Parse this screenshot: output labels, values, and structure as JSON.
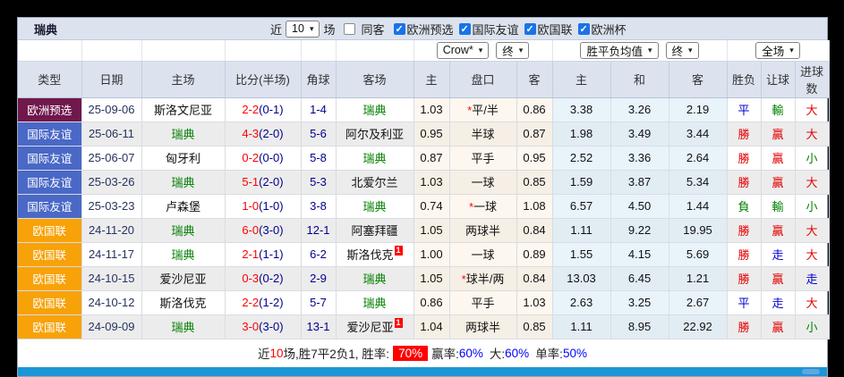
{
  "toolbar": {
    "team": "瑞典",
    "recent_label": "近",
    "recent_value": "10",
    "matches_label": "场",
    "same_venue_label": "同客",
    "same_venue_checked": false,
    "filters": [
      {
        "label": "欧洲预选",
        "checked": true
      },
      {
        "label": "国际友谊",
        "checked": true
      },
      {
        "label": "欧国联",
        "checked": true
      },
      {
        "label": "欧洲杯",
        "checked": true
      }
    ]
  },
  "selects": {
    "company": "Crow*",
    "ah_state": "终",
    "odds_mean": "胜平负均值",
    "odds_state": "终",
    "scope": "全场"
  },
  "table": {
    "headers": [
      "类型",
      "日期",
      "主场",
      "比分(半场)",
      "角球",
      "客场",
      "主",
      "盘口",
      "客",
      "主",
      "和",
      "客",
      "胜负",
      "让球",
      "进球数"
    ],
    "rows": [
      {
        "type": "欧洲预选",
        "date": "25-09-06",
        "home": "斯洛文尼亚",
        "home_team": false,
        "home_card": "",
        "ft": "2-2",
        "ht": "(0-1)",
        "corner": "1-4",
        "away": "瑞典",
        "away_team": true,
        "away_card": "",
        "ah_home": "1.03",
        "ah_star": true,
        "ah_line": "平/半",
        "ah_away": "0.86",
        "o_home": "3.38",
        "o_draw": "3.26",
        "o_away": "2.19",
        "res": "平",
        "res_c": "blue",
        "ah_res": "輸",
        "ah_res_c": "green",
        "goal": "大",
        "goal_c": "red"
      },
      {
        "type": "国际友谊",
        "date": "25-06-11",
        "home": "瑞典",
        "home_team": true,
        "home_card": "",
        "ft": "4-3",
        "ht": "(2-0)",
        "corner": "5-6",
        "away": "阿尔及利亚",
        "away_team": false,
        "away_card": "",
        "ah_home": "0.95",
        "ah_star": false,
        "ah_line": "半球",
        "ah_away": "0.87",
        "o_home": "1.98",
        "o_draw": "3.49",
        "o_away": "3.44",
        "res": "勝",
        "res_c": "red",
        "ah_res": "贏",
        "ah_res_c": "red",
        "goal": "大",
        "goal_c": "red"
      },
      {
        "type": "国际友谊",
        "date": "25-06-07",
        "home": "匈牙利",
        "home_team": false,
        "home_card": "",
        "ft": "0-2",
        "ht": "(0-0)",
        "corner": "5-8",
        "away": "瑞典",
        "away_team": true,
        "away_card": "",
        "ah_home": "0.87",
        "ah_star": false,
        "ah_line": "平手",
        "ah_away": "0.95",
        "o_home": "2.52",
        "o_draw": "3.36",
        "o_away": "2.64",
        "res": "勝",
        "res_c": "red",
        "ah_res": "贏",
        "ah_res_c": "red",
        "goal": "小",
        "goal_c": "green"
      },
      {
        "type": "国际友谊",
        "date": "25-03-26",
        "home": "瑞典",
        "home_team": true,
        "home_card": "",
        "ft": "5-1",
        "ht": "(2-0)",
        "corner": "5-3",
        "away": "北爱尔兰",
        "away_team": false,
        "away_card": "",
        "ah_home": "1.03",
        "ah_star": false,
        "ah_line": "一球",
        "ah_away": "0.85",
        "o_home": "1.59",
        "o_draw": "3.87",
        "o_away": "5.34",
        "res": "勝",
        "res_c": "red",
        "ah_res": "贏",
        "ah_res_c": "red",
        "goal": "大",
        "goal_c": "red"
      },
      {
        "type": "国际友谊",
        "date": "25-03-23",
        "home": "卢森堡",
        "home_team": false,
        "home_card": "",
        "ft": "1-0",
        "ht": "(1-0)",
        "corner": "3-8",
        "away": "瑞典",
        "away_team": true,
        "away_card": "",
        "ah_home": "0.74",
        "ah_star": true,
        "ah_line": "一球",
        "ah_away": "1.08",
        "o_home": "6.57",
        "o_draw": "4.50",
        "o_away": "1.44",
        "res": "負",
        "res_c": "green",
        "ah_res": "輸",
        "ah_res_c": "green",
        "goal": "小",
        "goal_c": "green"
      },
      {
        "type": "欧国联",
        "date": "24-11-20",
        "home": "瑞典",
        "home_team": true,
        "home_card": "",
        "ft": "6-0",
        "ht": "(3-0)",
        "corner": "12-1",
        "away": "阿塞拜疆",
        "away_team": false,
        "away_card": "",
        "ah_home": "1.05",
        "ah_star": false,
        "ah_line": "两球半",
        "ah_away": "0.84",
        "o_home": "1.11",
        "o_draw": "9.22",
        "o_away": "19.95",
        "res": "勝",
        "res_c": "red",
        "ah_res": "贏",
        "ah_res_c": "red",
        "goal": "大",
        "goal_c": "red"
      },
      {
        "type": "欧国联",
        "date": "24-11-17",
        "home": "瑞典",
        "home_team": true,
        "home_card": "",
        "ft": "2-1",
        "ht": "(1-1)",
        "corner": "6-2",
        "away": "斯洛伐克",
        "away_team": false,
        "away_card": "1",
        "ah_home": "1.00",
        "ah_star": false,
        "ah_line": "一球",
        "ah_away": "0.89",
        "o_home": "1.55",
        "o_draw": "4.15",
        "o_away": "5.69",
        "res": "勝",
        "res_c": "red",
        "ah_res": "走",
        "ah_res_c": "blue",
        "goal": "大",
        "goal_c": "red"
      },
      {
        "type": "欧国联",
        "date": "24-10-15",
        "home": "爱沙尼亚",
        "home_team": false,
        "home_card": "",
        "ft": "0-3",
        "ht": "(0-2)",
        "corner": "2-9",
        "away": "瑞典",
        "away_team": true,
        "away_card": "",
        "ah_home": "1.05",
        "ah_star": true,
        "ah_line": "球半/两",
        "ah_away": "0.84",
        "o_home": "13.03",
        "o_draw": "6.45",
        "o_away": "1.21",
        "res": "勝",
        "res_c": "red",
        "ah_res": "贏",
        "ah_res_c": "red",
        "goal": "走",
        "goal_c": "blue"
      },
      {
        "type": "欧国联",
        "date": "24-10-12",
        "home": "斯洛伐克",
        "home_team": false,
        "home_card": "",
        "ft": "2-2",
        "ht": "(1-2)",
        "corner": "5-7",
        "away": "瑞典",
        "away_team": true,
        "away_card": "",
        "ah_home": "0.86",
        "ah_star": false,
        "ah_line": "平手",
        "ah_away": "1.03",
        "o_home": "2.63",
        "o_draw": "3.25",
        "o_away": "2.67",
        "res": "平",
        "res_c": "blue",
        "ah_res": "走",
        "ah_res_c": "blue",
        "goal": "大",
        "goal_c": "red"
      },
      {
        "type": "欧国联",
        "date": "24-09-09",
        "home": "瑞典",
        "home_team": true,
        "home_card": "",
        "ft": "3-0",
        "ht": "(3-0)",
        "corner": "13-1",
        "away": "爱沙尼亚",
        "away_team": false,
        "away_card": "1",
        "ah_home": "1.04",
        "ah_star": false,
        "ah_line": "两球半",
        "ah_away": "0.85",
        "o_home": "1.11",
        "o_draw": "8.95",
        "o_away": "22.92",
        "res": "勝",
        "res_c": "red",
        "ah_res": "贏",
        "ah_res_c": "red",
        "goal": "小",
        "goal_c": "green"
      }
    ]
  },
  "summary": {
    "recent_label": "近",
    "recent_count": "10",
    "record_text": "场,胜7平2负1, 胜率:",
    "win_rate": "70%",
    "win_odds_label": "赢率:",
    "win_odds_value": "60%",
    "big_label": "大:",
    "big_value": "60%",
    "single_label": "单率:",
    "single_value": "50%"
  },
  "colors": {
    "type_colors": {
      "欧洲预选": "#70184C",
      "国际友谊": "#4A68C6",
      "欧国联": "#F7A208"
    },
    "team_green": "#008000",
    "result_red": "#E60000",
    "result_blue": "#0000CC",
    "result_green": "#008000",
    "score_ft_red": "#FF0000",
    "score_ht_navy": "#00008B",
    "header_bg": "#DCE3EF",
    "checkbox_accent": "#1A73E8",
    "win_rate_badge_bg": "#FF0000",
    "scrollbar_track": "#1D96D6",
    "scrollbar_thumb": "#5FA6E2"
  }
}
